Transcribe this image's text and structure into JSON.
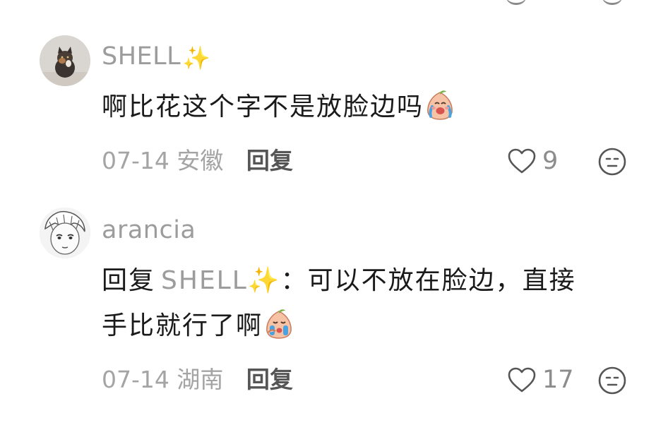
{
  "comments": [
    {
      "username": "SHELL",
      "username_emoji": "✨",
      "text": "啊比花这个字不是放脸边吗",
      "date": "07-14",
      "location": "安徽",
      "reply_label": "回复",
      "like_count": "9"
    },
    {
      "username": "arancia",
      "reply_prefix": "回复",
      "reply_to": "SHELL✨",
      "reply_colon": "：",
      "text_line1": "可以不放在脸边，直接",
      "text_line2": "手比就行了啊",
      "date": "07-14",
      "location": "湖南",
      "reply_label": "回复",
      "like_count": "17"
    }
  ],
  "icons": {
    "like": "heart-outline-icon",
    "dislike": "neutral-face-icon",
    "emoji": "crying-peach-emoji"
  },
  "colors": {
    "username": "#9c9c9c",
    "text": "#1a1a1a",
    "meta": "#a4a4a4",
    "reply_button": "#555555"
  }
}
